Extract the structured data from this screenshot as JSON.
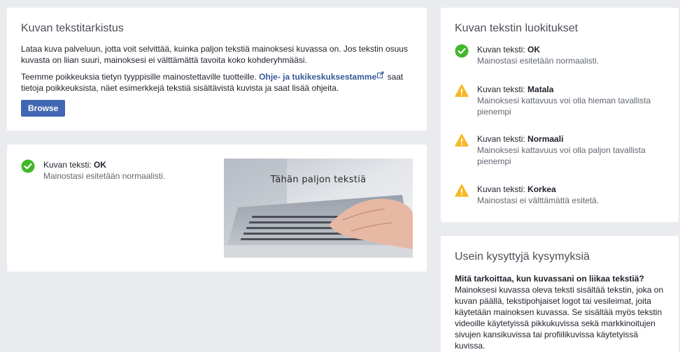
{
  "checker": {
    "title": "Kuvan tekstitarkistus",
    "intro": "Lataa kuva palveluun, jotta voit selvittää, kuinka paljon tekstiä mainoksesi kuvassa on. Jos tekstin osuus kuvasta on liian suuri, mainoksesi ei välttämättä tavoita koko kohderyhmääsi.",
    "exceptions_before": "Teemme poikkeuksia tietyn tyyppisille mainostettaville tuotteille. ",
    "exceptions_link": "Ohje- ja tukikeskuksestamme",
    "exceptions_after": " saat tietoja poikkeuksista, näet esimerkkejä tekstiä sisältävistä kuvista ja saat lisää ohjeita.",
    "browse_label": "Browse"
  },
  "result": {
    "label": "Kuvan teksti: ",
    "value": "OK",
    "description": "Mainostasi esitetään normaalisti.",
    "image_caption": "Tähän paljon tekstiä"
  },
  "ratings": {
    "title": "Kuvan tekstin luokitukset",
    "items": [
      {
        "label": "Kuvan teksti: ",
        "value": "OK",
        "description": "Mainostasi esitetään normaalisti.",
        "icon": "check-icon"
      },
      {
        "label": "Kuvan teksti: ",
        "value": "Matala",
        "description": "Mainoksesi kattavuus voi olla hieman tavallista pienempi",
        "icon": "warning-icon"
      },
      {
        "label": "Kuvan teksti: ",
        "value": "Normaali",
        "description": "Mainoksesi kattavuus voi olla paljon tavallista pienempi",
        "icon": "warning-icon"
      },
      {
        "label": "Kuvan teksti: ",
        "value": "Korkea",
        "description": "Mainostasi ei välttämättä esitetä.",
        "icon": "warning-icon"
      }
    ]
  },
  "faq": {
    "title": "Usein kysyttyjä kysymyksiä",
    "question": "Mitä tarkoittaa, kun kuvassani on liikaa tekstiä?",
    "answer": "Mainoksesi kuvassa oleva teksti sisältää tekstin, joka on kuvan päällä, tekstipohjaiset logot tai vesileimat, joita käytetään mainoksen kuvassa. Se sisältää myös tekstin videoille käytetyissä pikkukuvissa sekä markkinoitujen sivujen kansikuvissa tai profiilikuvissa käytetyissä kuvissa."
  },
  "colors": {
    "ok_green": "#42b72a",
    "warning_yellow": "#f7b928",
    "button_blue": "#4267b2",
    "link_blue": "#365899"
  }
}
